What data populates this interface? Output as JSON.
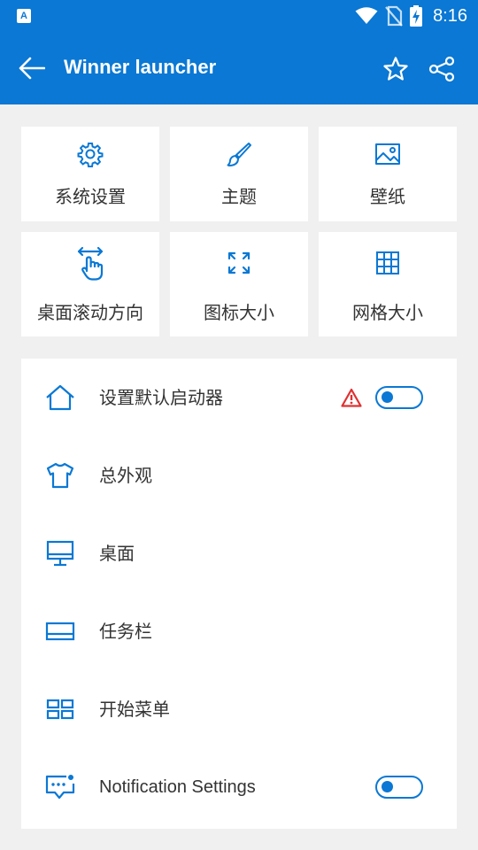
{
  "statusbar": {
    "app_badge": "A",
    "time": "8:16"
  },
  "appbar": {
    "title": "Winner launcher",
    "back_icon": "arrow-left-icon",
    "favorite_icon": "star-icon",
    "share_icon": "share-icon"
  },
  "tiles": [
    {
      "label": "系统设置",
      "icon": "gear-icon"
    },
    {
      "label": "主题",
      "icon": "brush-icon"
    },
    {
      "label": "壁纸",
      "icon": "image-icon"
    },
    {
      "label": "桌面滚动方向",
      "icon": "swipe-hand-icon"
    },
    {
      "label": "图标大小",
      "icon": "expand-icon"
    },
    {
      "label": "网格大小",
      "icon": "grid-icon"
    }
  ],
  "settings": [
    {
      "label": "设置默认启动器",
      "icon": "home-icon",
      "warning": true,
      "toggle": false
    },
    {
      "label": "总外观",
      "icon": "shirt-icon"
    },
    {
      "label": "桌面",
      "icon": "monitor-icon"
    },
    {
      "label": "任务栏",
      "icon": "taskbar-icon"
    },
    {
      "label": "开始菜单",
      "icon": "start-menu-icon"
    },
    {
      "label": "Notification Settings",
      "icon": "notification-chat-icon",
      "toggle": false
    }
  ],
  "colors": {
    "accent": "#0a78d4",
    "background": "#f0f0f0",
    "card": "#ffffff",
    "warning": "#e03030",
    "text": "#333333"
  }
}
